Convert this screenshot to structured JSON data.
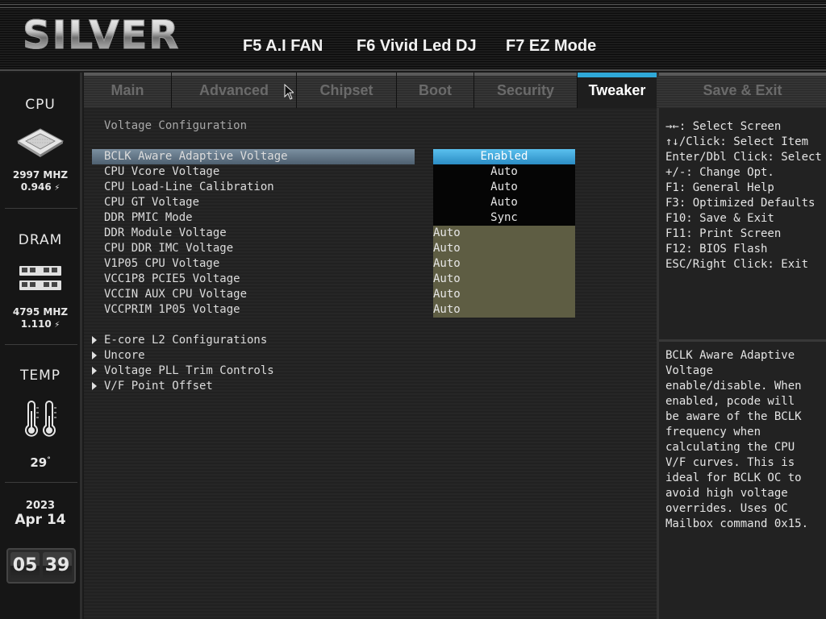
{
  "header": {
    "logo": "SILVER",
    "fkeys": [
      "F5 A.I FAN",
      "F6 Vivid Led DJ",
      "F7 EZ Mode"
    ]
  },
  "tabs": [
    {
      "label": "Main",
      "active": false
    },
    {
      "label": "Advanced",
      "active": false
    },
    {
      "label": "Chipset",
      "active": false
    },
    {
      "label": "Boot",
      "active": false
    },
    {
      "label": "Security",
      "active": false
    },
    {
      "label": "Tweaker",
      "active": true
    },
    {
      "label": "Save & Exit",
      "active": false
    }
  ],
  "sidebar": {
    "cpu": {
      "title": "CPU",
      "freq": "2997 MHZ",
      "volt": "0.946",
      "icon": "cpu-chip-icon"
    },
    "dram": {
      "title": "DRAM",
      "freq": "4795 MHZ",
      "volt": "1.110",
      "icon": "memory-module-icon"
    },
    "temp": {
      "title": "TEMP",
      "value": "29",
      "unit": "°",
      "icon": "thermometer-icon"
    },
    "date": {
      "year": "2023",
      "month_day": "Apr 14"
    },
    "clock": {
      "hours": "05",
      "minutes": "39"
    }
  },
  "main": {
    "section_title": "Voltage Configuration",
    "rows": [
      {
        "label": "BCLK Aware Adaptive Voltage",
        "value": "Enabled",
        "style": "blue",
        "selected": true
      },
      {
        "label": "CPU Vcore Voltage",
        "value": "Auto",
        "style": "black"
      },
      {
        "label": "CPU Load-Line Calibration",
        "value": "Auto",
        "style": "black"
      },
      {
        "label": "CPU GT Voltage",
        "value": "Auto",
        "style": "black"
      },
      {
        "label": "DDR PMIC Mode",
        "value": "Sync",
        "style": "black"
      },
      {
        "label": "DDR Module Voltage",
        "value": "Auto",
        "style": "olive"
      },
      {
        "label": "CPU DDR IMC Voltage",
        "value": "Auto",
        "style": "olive"
      },
      {
        "label": "V1P05 CPU Voltage",
        "value": "Auto",
        "style": "olive"
      },
      {
        "label": "VCC1P8 PCIE5 Voltage",
        "value": "Auto",
        "style": "olive"
      },
      {
        "label": "VCCIN AUX CPU Voltage",
        "value": "Auto",
        "style": "olive"
      },
      {
        "label": "VCCPRIM 1P05 Voltage",
        "value": "Auto",
        "style": "olive"
      }
    ],
    "submenus": [
      "E-core L2 Configurations",
      "Uncore",
      "Voltage PLL Trim Controls",
      "V/F Point Offset"
    ]
  },
  "help": {
    "keys": [
      "→←: Select Screen",
      "↑↓/Click: Select Item",
      "Enter/Dbl Click: Select",
      "+/-: Change Opt.",
      "F1: General Help",
      "F3: Optimized Defaults",
      "F10: Save & Exit",
      "F11: Print Screen",
      "F12: BIOS Flash",
      "ESC/Right Click: Exit"
    ],
    "description": "BCLK Aware Adaptive\nVoltage\nenable/disable. When\nenabled, pcode will\nbe aware of the BCLK\nfrequency when\ncalculating the CPU\nV/F curves. This is\nideal for BCLK OC to\navoid high voltage\noverrides. Uses OC\nMailbox command 0x15."
  },
  "colors": {
    "accent": "#2fa8d8",
    "selected_value": "#3aa6dc",
    "olive_value": "#5e5d43"
  }
}
